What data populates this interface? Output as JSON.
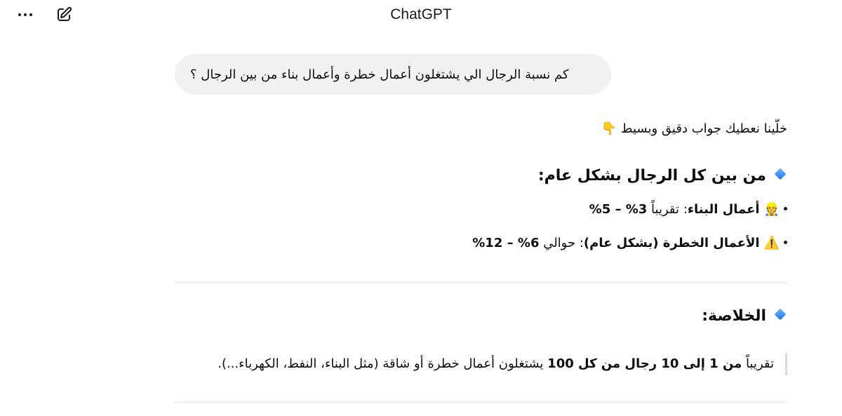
{
  "header": {
    "title": "ChatGPT",
    "more_icon": "more-horizontal-icon",
    "edit_icon": "new-chat-edit-icon"
  },
  "user_message": "كم نسبة الرجال الي يشتغلون أعمال خطرة وأعمال بناء من بين الرجال ؟",
  "assistant": {
    "intro": "خلّينا نعطيك جواب دقيق وبسيط",
    "intro_emoji": "👇",
    "section1": {
      "icon": "🔹",
      "title": "من بين كل الرجال بشكل عام:",
      "bullets": [
        {
          "emoji": "👷",
          "label": "أعمال البناء",
          "text": ": تقريباً ",
          "value": "3% – 5%"
        },
        {
          "emoji": "⚠️",
          "label": "الأعمال الخطرة (بشكل عام)",
          "text": ": حوالي ",
          "value": "6% – 12%"
        }
      ]
    },
    "section2": {
      "icon": "🔹",
      "title": "الخلاصة:",
      "summary_prefix": "تقريباً ",
      "summary_bold": "من 1 إلى 10 رجال من كل 100",
      "summary_rest": " يشتغلون أعمال خطرة أو شاقة (مثل البناء، النفط، الكهرباء...)."
    }
  }
}
